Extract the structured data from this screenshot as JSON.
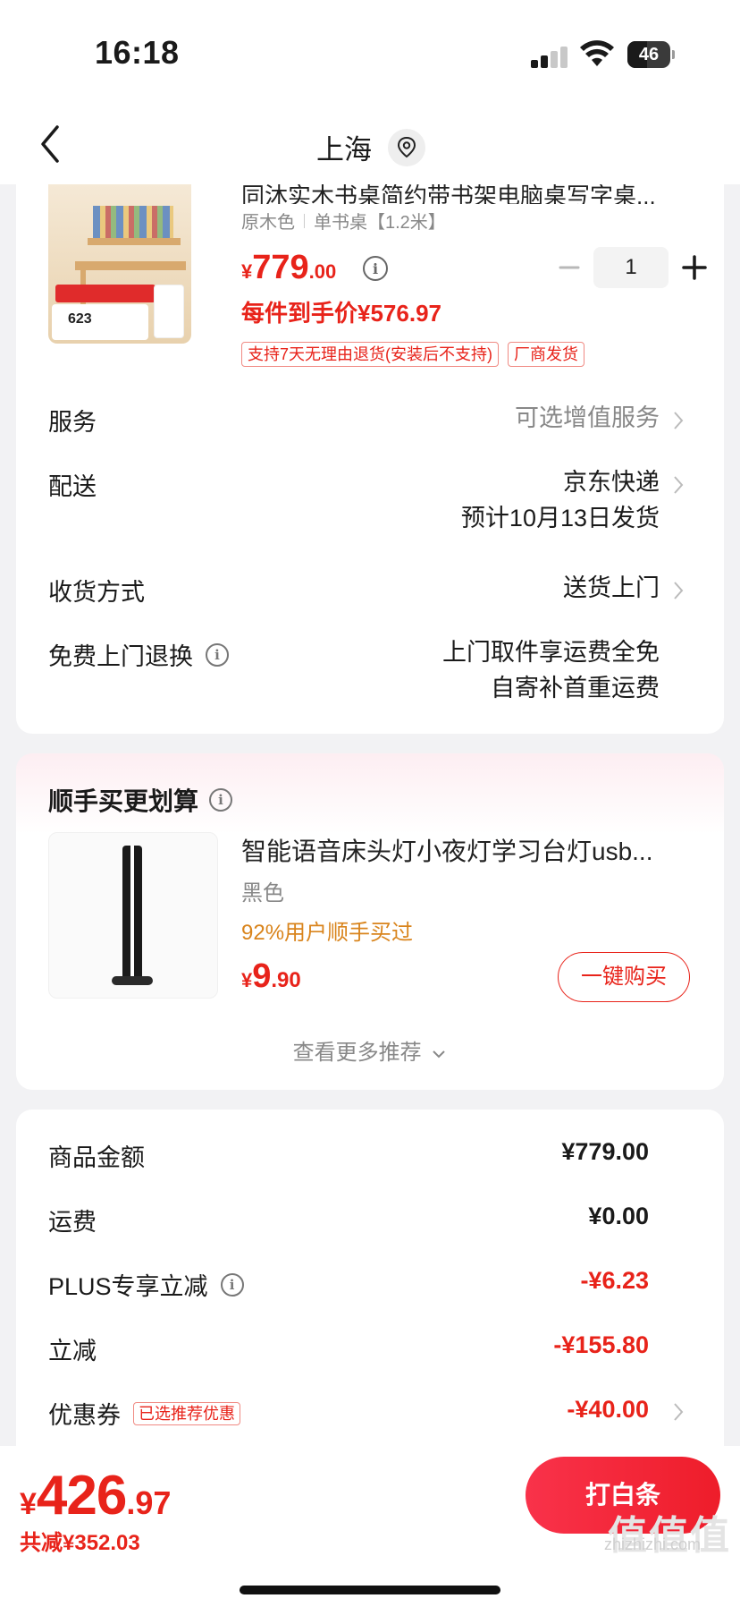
{
  "status_bar": {
    "time": "16:18",
    "battery": "46"
  },
  "nav": {
    "title": "上海"
  },
  "product": {
    "name": "同沐实木书桌简约带书架电脑桌写字桌...",
    "spec_color": "原木色",
    "spec_size": "单书桌【1.2米】",
    "price_symbol": "¥",
    "price_int": "779",
    "price_dec": ".00",
    "quantity": "1",
    "hand_price": "每件到手价¥576.97",
    "tags": [
      "支持7天无理由退货(安装后不支持)",
      "厂商发货"
    ],
    "thumb_number": "623"
  },
  "rows": {
    "service_label": "服务",
    "service_value": "可选增值服务",
    "delivery_label": "配送",
    "delivery_value": "京东快递",
    "delivery_eta": "预计10月13日发货",
    "receive_label": "收货方式",
    "receive_value": "送货上门",
    "return_label": "免费上门退换",
    "return_value_1": "上门取件享运费全免",
    "return_value_2": "自寄补首重运费"
  },
  "bundle": {
    "title": "顺手买更划算",
    "name": "智能语音床头灯小夜灯学习台灯usb...",
    "color": "黑色",
    "stat": "92%用户顺手买过",
    "price_symbol": "¥",
    "price_int": "9",
    "price_dec": ".90",
    "buy_label": "一键购买",
    "more_label": "查看更多推荐"
  },
  "summary": {
    "goods_label": "商品金额",
    "goods_value": "¥779.00",
    "shipping_label": "运费",
    "shipping_value": "¥0.00",
    "plus_label": "PLUS专享立减",
    "plus_value": "-¥6.23",
    "discount_label": "立减",
    "discount_value": "-¥155.80",
    "coupon_label": "优惠券",
    "coupon_tag": "已选推荐优惠",
    "coupon_value": "-¥40.00"
  },
  "bottom": {
    "total_symbol": "¥",
    "total_int": "426",
    "total_dec": ".97",
    "saved": "共减¥352.03",
    "pay_label": "打白条",
    "watermark": "zhizhizhi.com",
    "watermark_big": "值值值"
  },
  "colors": {
    "accent": "#e8231a",
    "orange": "#d9841c",
    "background": "#f2f2f4"
  }
}
